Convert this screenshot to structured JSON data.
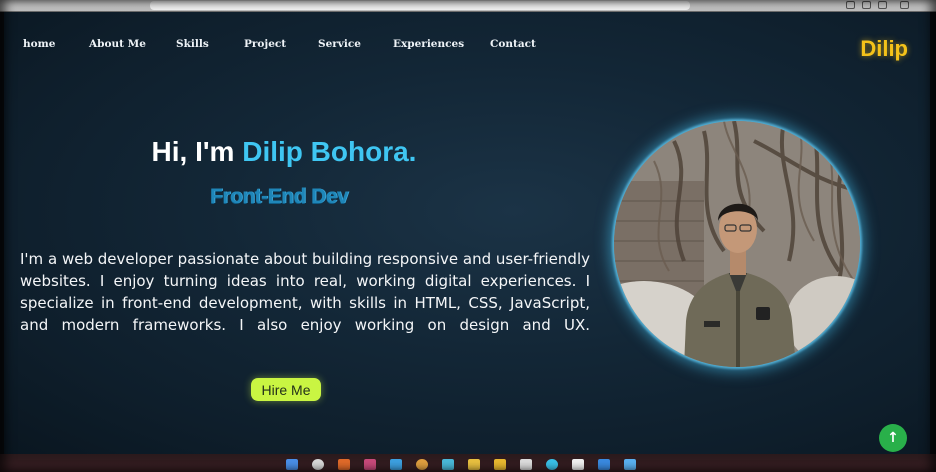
{
  "nav": {
    "links": [
      {
        "label": "home"
      },
      {
        "label": "About Me"
      },
      {
        "label": "Skills"
      },
      {
        "label": "Project"
      },
      {
        "label": "Service"
      },
      {
        "label": "Experiences"
      },
      {
        "label": "Contact"
      }
    ],
    "logo": "Dilip"
  },
  "hero": {
    "greeting": "Hi, I'm ",
    "name": "Dilip Bohora.",
    "role": "Front-End Dev",
    "description": "I'm a web developer passionate about building responsive and user-friendly websites. I enjoy turning ideas into real, working digital experiences. I specialize in front-end development, with skills in HTML, CSS, JavaScript, and modern frameworks. I also enjoy working on design and UX.",
    "hire_button": "Hire Me"
  },
  "scroll_top_icon": "arrow-up-icon",
  "colors": {
    "accent_name": "#3fc6f2",
    "logo": "#f4c21a",
    "hire_button": "#c9f542",
    "scroll_button": "#29b04a",
    "background": "#132737"
  }
}
